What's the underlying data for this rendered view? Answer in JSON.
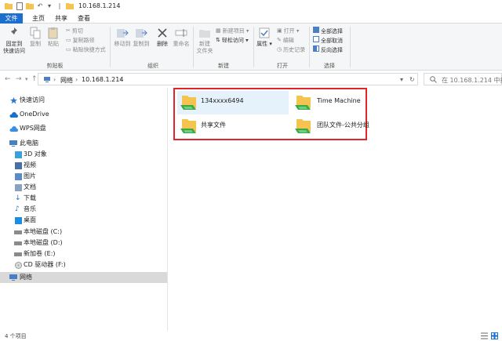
{
  "window": {
    "title": "10.168.1.214"
  },
  "tabs": [
    {
      "label": "文件",
      "active": true
    },
    {
      "label": "主页",
      "active": false
    },
    {
      "label": "共享",
      "active": false
    },
    {
      "label": "查看",
      "active": false
    }
  ],
  "ribbon": {
    "clipboard": {
      "pin_label_1": "固定到",
      "pin_label_2": "快速访问",
      "copy_label": "复制",
      "paste_label": "粘贴",
      "cut_label": "剪切",
      "copy_path_label": "复制路径",
      "paste_shortcut_label": "粘贴快捷方式",
      "group_label": "剪贴板"
    },
    "organize": {
      "move_to_label": "移动到",
      "copy_to_label": "复制到",
      "delete_label": "删除",
      "rename_label": "重命名",
      "group_label": "组织"
    },
    "new": {
      "new_folder_label_1": "新建",
      "new_folder_label_2": "文件夹",
      "new_item_label": "新建项目",
      "easy_access_label": "轻松访问",
      "group_label": "新建"
    },
    "open": {
      "properties_label": "属性",
      "open_label": "打开",
      "edit_label": "编辑",
      "history_label": "历史记录",
      "group_label": "打开"
    },
    "select": {
      "select_all_label": "全部选择",
      "select_none_label": "全部取消",
      "invert_label": "反向选择",
      "group_label": "选择"
    }
  },
  "address": {
    "crumbs": [
      "网络",
      "10.168.1.214"
    ],
    "search_placeholder": "在 10.168.1.214 中搜..."
  },
  "nav": {
    "quick_access": "快速访问",
    "onedrive": "OneDrive",
    "wps": "WPS网盘",
    "this_pc": "此电脑",
    "items": [
      "3D 对象",
      "视频",
      "图片",
      "文档",
      "下载",
      "音乐",
      "桌面",
      "本地磁盘 (C:)",
      "本地磁盘 (D:)",
      "新加卷 (E:)",
      "CD 驱动器 (F:)"
    ],
    "network": "网络"
  },
  "content": {
    "shares": [
      {
        "name": "134xxxx6494",
        "selected": true
      },
      {
        "name": "Time Machine",
        "selected": false
      },
      {
        "name": "共享文件",
        "selected": false
      },
      {
        "name": "团队文件-公共分组",
        "selected": false
      }
    ]
  },
  "status": {
    "count": "4 个项目"
  },
  "colors": {
    "accent": "#1a6fcf",
    "highlight": "#e0262b",
    "selection": "#e5f1fb"
  }
}
